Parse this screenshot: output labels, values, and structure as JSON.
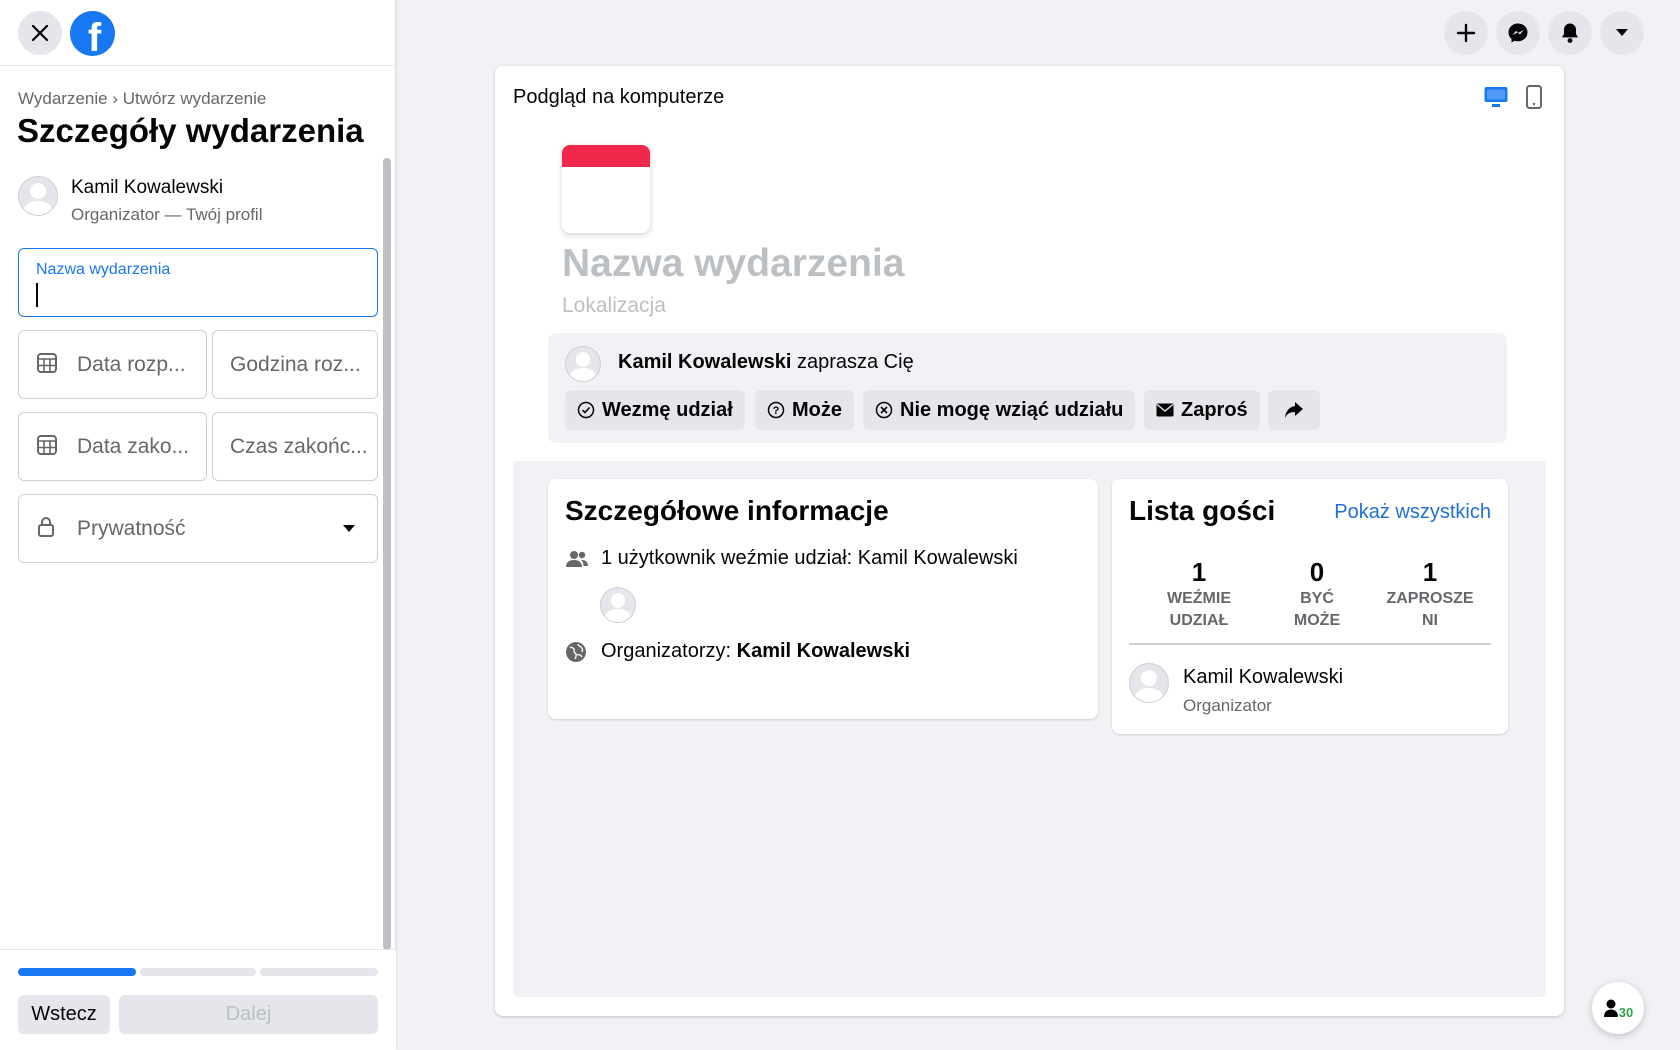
{
  "sidebar": {
    "breadcrumb": "Wydarzenie › Utwórz wydarzenie",
    "title": "Szczegóły wydarzenia",
    "organizer_name": "Kamil Kowalewski",
    "organizer_sub": "Organizator — Twój profil",
    "event_name_label": "Nazwa wydarzenia",
    "event_name_value": "",
    "start_date_placeholder": "Data rozp...",
    "start_time_placeholder": "Godzina roz...",
    "end_date_placeholder": "Data zako...",
    "end_time_placeholder": "Czas zakońc...",
    "privacy_placeholder": "Prywatność",
    "progress_step": 1,
    "progress_total": 3,
    "back_label": "Wstecz",
    "next_label": "Dalej"
  },
  "preview": {
    "title": "Podgląd na komputerze",
    "event_name": "Nazwa wydarzenia",
    "location": "Lokalizacja",
    "inviter_name": "Kamil Kowalewski",
    "invite_suffix": "zaprasza Cię",
    "rsvp": {
      "going": "Wezmę udział",
      "maybe": "Może",
      "cant_go": "Nie mogę wziąć udziału",
      "invite": "Zaproś"
    },
    "details": {
      "title": "Szczegółowe informacje",
      "going_line": "1 użytkownik weźmie udział: Kamil Kowalewski",
      "organizers_label": "Organizatorzy:",
      "organizers_name": "Kamil Kowalewski"
    },
    "guests": {
      "title": "Lista gości",
      "show_all": "Pokaż wszystkich",
      "stats": [
        {
          "num": "1",
          "label_line1": "WEŹMIE",
          "label_line2": "UDZIAŁ"
        },
        {
          "num": "0",
          "label_line1": "BYĆ",
          "label_line2": "MOŻE"
        },
        {
          "num": "1",
          "label_line1": "ZAPROSZE",
          "label_line2": "NI"
        }
      ],
      "guest_name": "Kamil Kowalewski",
      "guest_role": "Organizator"
    }
  },
  "contacts_badge": "30",
  "colors": {
    "accent": "#1877f2",
    "calendar_red": "#f02849",
    "online_green": "#31a24c",
    "placeholder_gray": "#bcc0c4"
  }
}
